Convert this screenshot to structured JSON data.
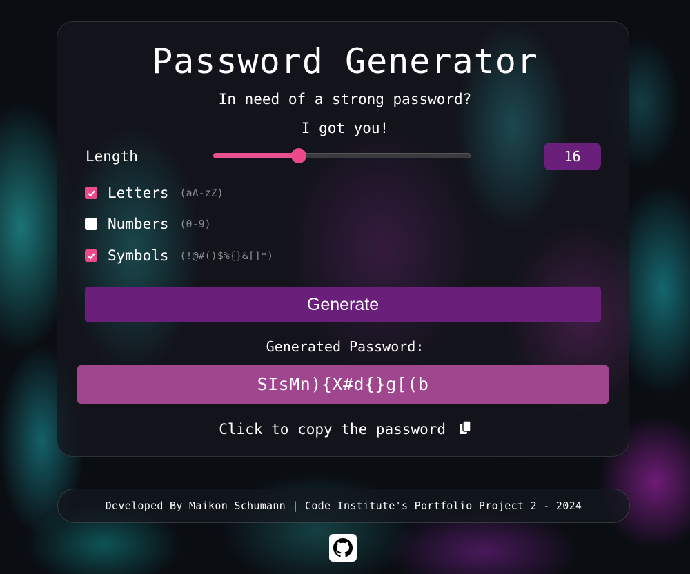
{
  "header": {
    "title": "Password Generator",
    "subtitle": "In need of a strong password?",
    "tagline": "I got you!"
  },
  "length": {
    "label": "Length",
    "value": "16",
    "min": 8,
    "max": 32,
    "current": 16
  },
  "options": [
    {
      "label": "Letters",
      "hint": "(aA-zZ)",
      "checked": true
    },
    {
      "label": "Numbers",
      "hint": "(0-9)",
      "checked": false
    },
    {
      "label": "Symbols",
      "hint": "(!@#()$%{}&[]*)",
      "checked": true
    }
  ],
  "generate_label": "Generate",
  "output": {
    "label": "Generated Password:",
    "password": "SIsMn){X#d{}g[(b",
    "copy_text": "Click to copy the password"
  },
  "footer": {
    "text": "Developed By Maikon Schumann | Code Institute's Portfolio Project 2 - 2024"
  },
  "icons": {
    "copy": "copy-icon",
    "github": "github-icon"
  },
  "colors": {
    "accent": "#ec4a8b",
    "button": "#6a207a",
    "password_bg": "#a0468f"
  }
}
